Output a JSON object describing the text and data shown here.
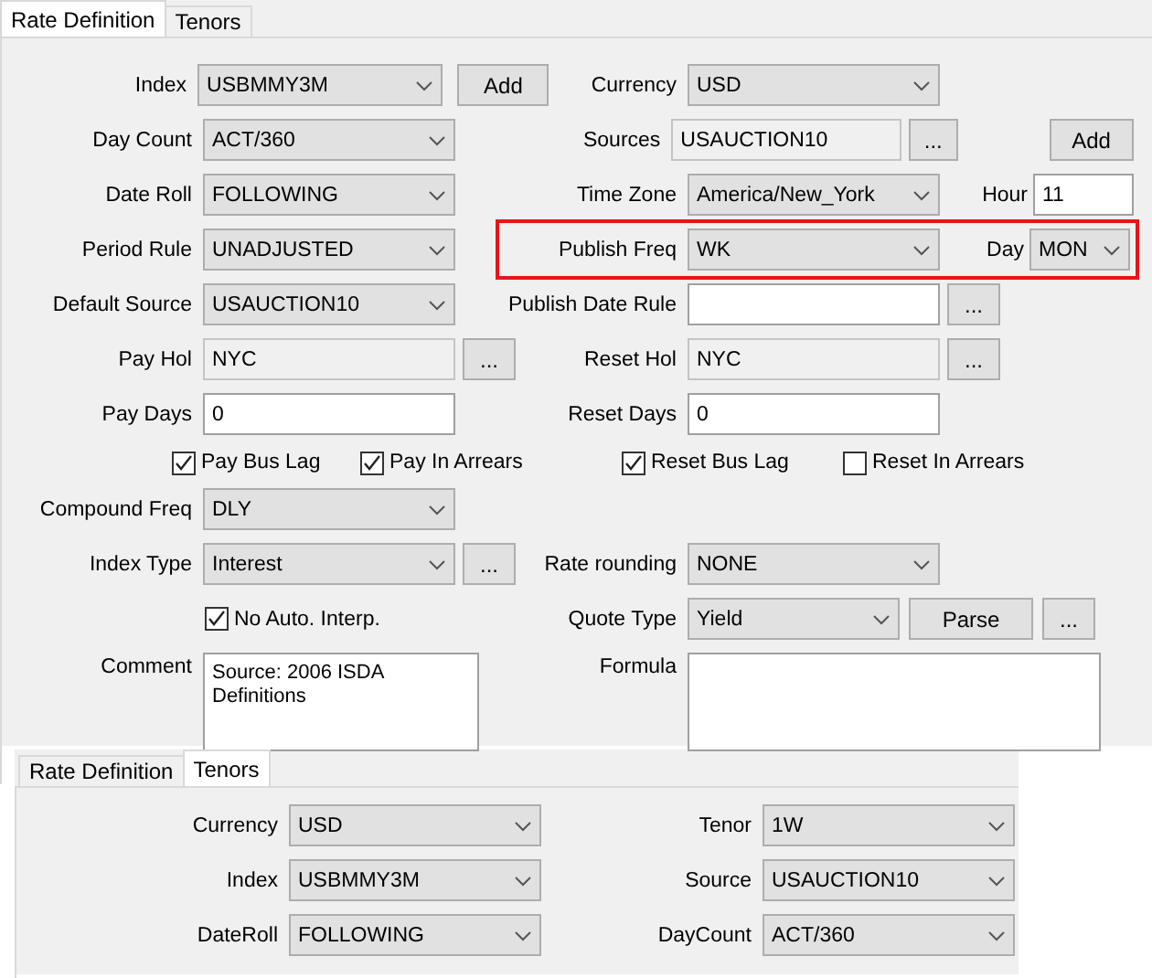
{
  "panels": [
    {
      "tabs": [
        {
          "label": "Rate Definition",
          "selected": true
        },
        {
          "label": "Tenors",
          "selected": false
        }
      ],
      "rows": [
        {
          "kind": "form",
          "left": {
            "label": "Index",
            "field": {
              "kind": "combo",
              "value": "USBMMY3M"
            },
            "buttons": [
              {
                "kind": "text",
                "label": "Add"
              }
            ]
          },
          "right": {
            "label": "Currency",
            "field": {
              "kind": "combo",
              "value": "USD"
            }
          }
        },
        {
          "kind": "form",
          "left": {
            "label": "Day Count",
            "field": {
              "kind": "combo",
              "value": "ACT/360"
            }
          },
          "right": {
            "label": "Sources",
            "field": {
              "kind": "readonly",
              "value": "USAUCTION10"
            },
            "buttons": [
              {
                "kind": "more",
                "label": "..."
              },
              {
                "kind": "text",
                "label": "Add"
              }
            ]
          }
        },
        {
          "kind": "form",
          "left": {
            "label": "Date Roll",
            "field": {
              "kind": "combo",
              "value": "FOLLOWING"
            }
          },
          "right": {
            "label": "Time Zone",
            "field": {
              "kind": "combo",
              "value": "America/New_York"
            },
            "extra": {
              "label": "Hour",
              "field": {
                "kind": "input",
                "value": "11"
              }
            }
          }
        },
        {
          "kind": "form",
          "left": {
            "label": "Period Rule",
            "field": {
              "kind": "combo",
              "value": "UNADJUSTED"
            }
          },
          "right": {
            "label": "Publish Freq",
            "field": {
              "kind": "combo",
              "value": "WK"
            },
            "extra": {
              "label": "Day",
              "field": {
                "kind": "combo",
                "value": "MON"
              }
            },
            "highlighted": true
          }
        },
        {
          "kind": "form",
          "left": {
            "label": "Default Source",
            "field": {
              "kind": "combo",
              "value": "USAUCTION10"
            }
          },
          "right": {
            "label": "Publish Date Rule",
            "field": {
              "kind": "input"
            },
            "buttons": [
              {
                "kind": "more",
                "label": "..."
              }
            ]
          }
        },
        {
          "kind": "form",
          "left": {
            "label": "Pay Hol",
            "field": {
              "kind": "readonly",
              "value": "NYC"
            },
            "buttons": [
              {
                "kind": "more",
                "label": "..."
              }
            ]
          },
          "right": {
            "label": "Reset Hol",
            "field": {
              "kind": "readonly",
              "value": "NYC"
            },
            "buttons": [
              {
                "kind": "more",
                "label": "..."
              }
            ]
          }
        },
        {
          "kind": "form",
          "left": {
            "label": "Pay Days",
            "field": {
              "kind": "input",
              "value": "0"
            }
          },
          "right": {
            "label": "Reset Days",
            "field": {
              "kind": "input",
              "value": "0"
            }
          }
        },
        {
          "kind": "checks",
          "left": {
            "checks": [
              {
                "label": "Pay Bus Lag",
                "checked": true
              },
              {
                "label": "Pay In Arrears",
                "checked": true
              }
            ]
          },
          "right": {
            "checks": [
              {
                "label": "Reset Bus Lag",
                "checked": true
              },
              {
                "label": "Reset In Arrears",
                "checked": false
              }
            ]
          }
        },
        {
          "kind": "form",
          "left": {
            "label": "Compound Freq",
            "field": {
              "kind": "combo",
              "value": "DLY"
            }
          }
        },
        {
          "kind": "form",
          "left": {
            "label": "Index Type",
            "field": {
              "kind": "combo",
              "value": "Interest"
            },
            "buttons": [
              {
                "kind": "more",
                "label": "..."
              }
            ]
          },
          "right": {
            "label": "Rate rounding",
            "field": {
              "kind": "combo",
              "value": "NONE"
            }
          }
        },
        {
          "kind": "form",
          "left": {
            "checks": [
              {
                "label": "No Auto. Interp.",
                "checked": true
              }
            ]
          },
          "right": {
            "label": "Quote Type",
            "field": {
              "kind": "combo",
              "value": "Yield"
            },
            "buttons": [
              {
                "kind": "text",
                "label": "Parse"
              },
              {
                "kind": "more",
                "label": "..."
              }
            ]
          }
        },
        {
          "kind": "form",
          "left": {
            "label": "Comment",
            "field": {
              "kind": "textarea",
              "value": "Source: 2006 ISDA Definitions"
            }
          },
          "right": {
            "label": "Formula",
            "field": {
              "kind": "textarea"
            }
          }
        }
      ]
    },
    {
      "tabs": [
        {
          "label": "Rate Definition",
          "selected": false
        },
        {
          "label": "Tenors",
          "selected": true
        }
      ],
      "rows": [
        {
          "kind": "form",
          "left": {
            "label": "Currency",
            "field": {
              "kind": "combo",
              "value": "USD"
            }
          },
          "right": {
            "label": "Tenor",
            "field": {
              "kind": "combo",
              "value": "1W"
            }
          }
        },
        {
          "kind": "form",
          "left": {
            "label": "Index",
            "field": {
              "kind": "combo",
              "value": "USBMMY3M"
            }
          },
          "right": {
            "label": "Source",
            "field": {
              "kind": "combo",
              "value": "USAUCTION10"
            }
          }
        },
        {
          "kind": "form",
          "left": {
            "label": "DateRoll",
            "field": {
              "kind": "combo",
              "value": "FOLLOWING"
            }
          },
          "right": {
            "label": "DayCount",
            "field": {
              "kind": "combo",
              "value": "ACT/360"
            }
          }
        }
      ]
    }
  ]
}
